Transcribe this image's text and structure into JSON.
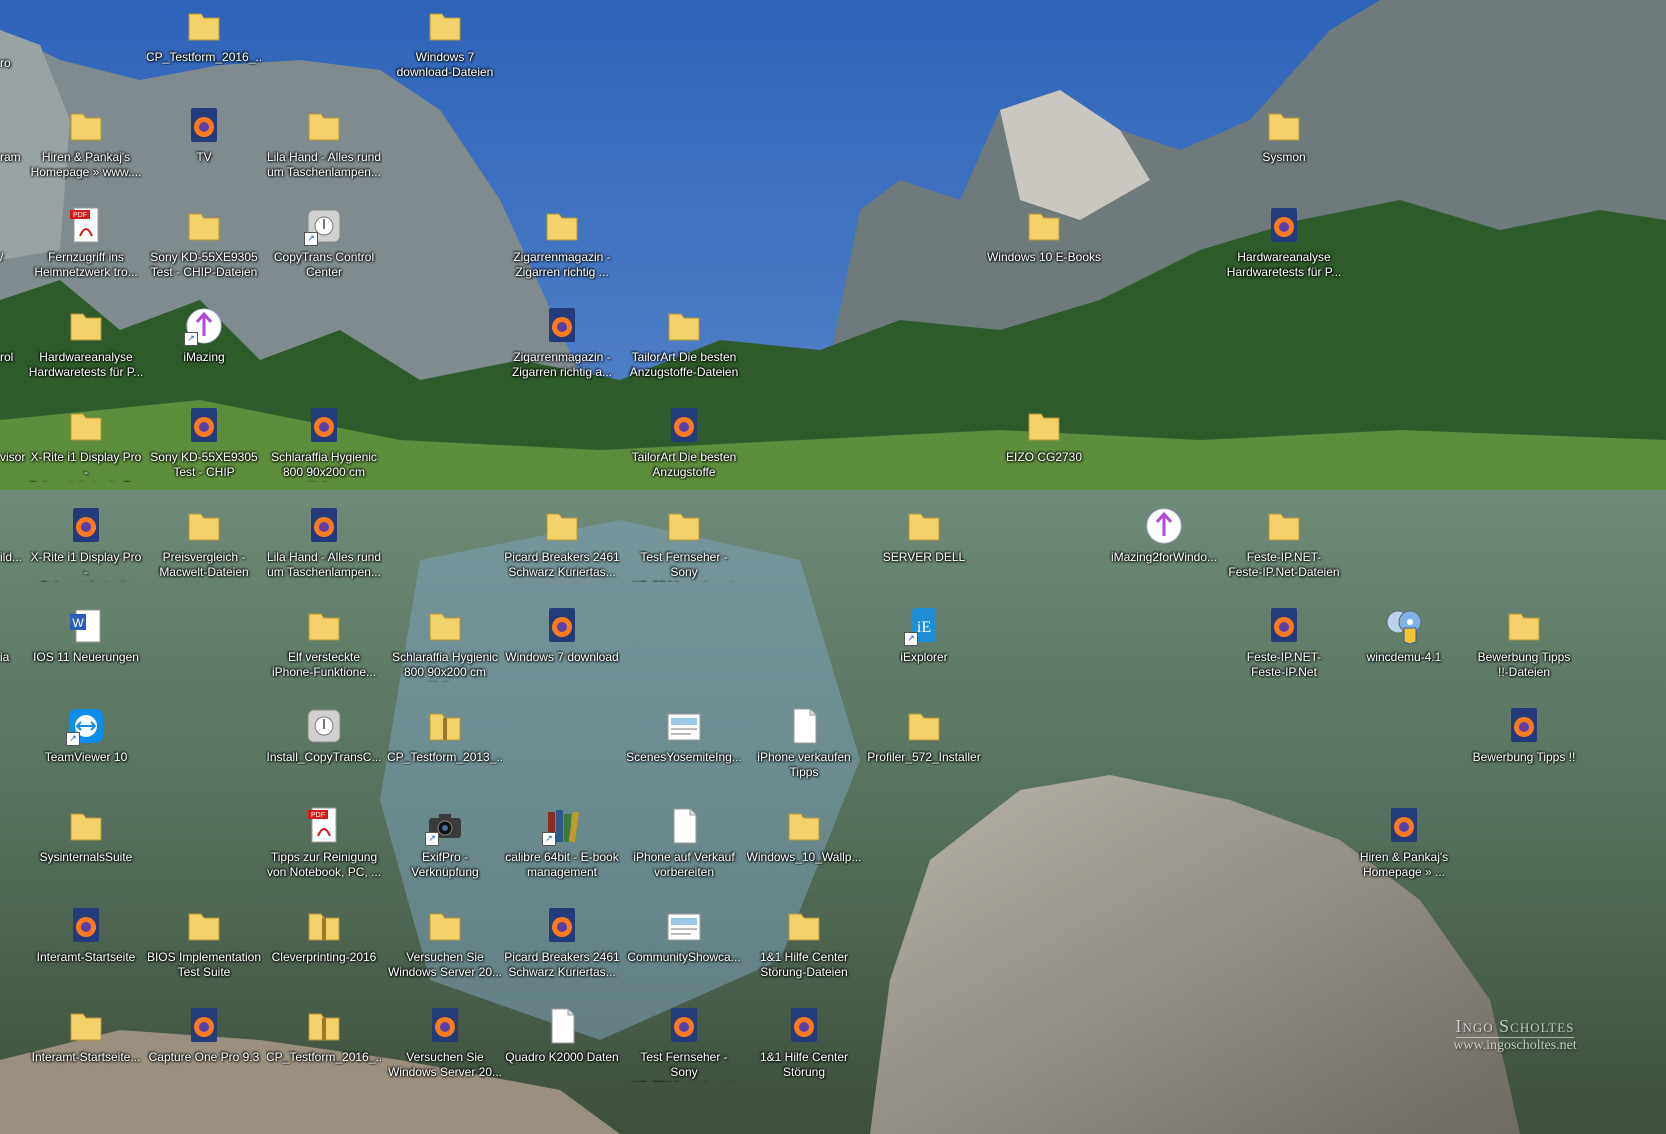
{
  "desktop": {
    "icons": [
      {
        "label": "ro",
        "type": "edge-text"
      },
      {
        "label": "CP_Testform_2016_...",
        "type": "folder"
      },
      {
        "label": "Windows 7\ndownload-Dateien",
        "type": "folder"
      },
      {
        "label": "ram",
        "type": "edge-text"
      },
      {
        "label": "Hiren & Pankaj's\nHomepage » www....",
        "type": "folder"
      },
      {
        "label": "TV",
        "type": "firefox"
      },
      {
        "label": "Lila Hand - Alles rund\num Taschenlampen...",
        "type": "folder"
      },
      {
        "label": "Sysmon",
        "type": "folder"
      },
      {
        "label": "/",
        "type": "edge-text"
      },
      {
        "label": "Fernzugriff ins\nHeimnetzwerk tro...",
        "type": "pdf"
      },
      {
        "label": "Sony KD-55XE9305\nTest - CHIP-Dateien",
        "type": "folder"
      },
      {
        "label": "CopyTrans Control\nCenter",
        "type": "app-gray"
      },
      {
        "label": "Zigarrenmagazin -\nZigarren richtig ...",
        "type": "folder"
      },
      {
        "label": "Windows 10 E-Books",
        "type": "folder"
      },
      {
        "label": "Hardwareanalyse\nHardwaretests für P...",
        "type": "firefox"
      },
      {
        "label": "rol",
        "type": "edge-text"
      },
      {
        "label": "Hardwareanalyse\nHardwaretests für P...",
        "type": "folder"
      },
      {
        "label": "iMazing",
        "type": "imazing"
      },
      {
        "label": "Zigarrenmagazin -\nZigarren richtig a...",
        "type": "firefox"
      },
      {
        "label": "TailorArt  Die besten\nAnzugstoffe-Dateien",
        "type": "folder"
      },
      {
        "label": "visor",
        "type": "edge-text"
      },
      {
        "label": "X-Rite i1 Display Pro -\nCalumetphoto.de-D...",
        "type": "folder"
      },
      {
        "label": "Sony KD-55XE9305\nTest - CHIP",
        "type": "firefox"
      },
      {
        "label": "Schlaraffia Hygienic\n800 90x200 cm Kalt...",
        "type": "firefox"
      },
      {
        "label": "TailorArt  Die besten\nAnzugstoffe",
        "type": "firefox"
      },
      {
        "label": "EIZO CG2730",
        "type": "folder"
      },
      {
        "label": "ild...",
        "type": "edge-text"
      },
      {
        "label": "X-Rite i1 Display Pro -\nCalumetphoto.de",
        "type": "firefox"
      },
      {
        "label": "Preisvergleich -\nMacwelt-Dateien",
        "type": "folder"
      },
      {
        "label": "Lila Hand - Alles rund\num Taschenlampen...",
        "type": "firefox"
      },
      {
        "label": "Picard Breakers 2461\nSchwarz   Kuriertas...",
        "type": "folder"
      },
      {
        "label": "Test Fernseher - Sony\nKD-55A1 - sehr gut ...",
        "type": "folder"
      },
      {
        "label": "SERVER DELL",
        "type": "folder"
      },
      {
        "label": "iMazing2forWindo...",
        "type": "imazing"
      },
      {
        "label": "Feste-IP.NET-\nFeste-IP.Net-Dateien",
        "type": "folder"
      },
      {
        "label": "ia",
        "type": "edge-text"
      },
      {
        "label": "IOS 11 Neuerungen",
        "type": "word"
      },
      {
        "label": "Elf versteckte\niPhone-Funktione...",
        "type": "folder"
      },
      {
        "label": "Schlaraffia Hygienic\n800 90x200 cm Kalt...",
        "type": "folder"
      },
      {
        "label": "Windows 7 download",
        "type": "firefox"
      },
      {
        "label": "iExplorer",
        "type": "iexplorer"
      },
      {
        "label": "Feste-IP.NET-\nFeste-IP.Net",
        "type": "firefox"
      },
      {
        "label": "wincdemu-4.1",
        "type": "disc"
      },
      {
        "label": "Bewerbung Tipps\n!!-Dateien",
        "type": "folder"
      },
      {
        "label": "TeamViewer 10",
        "type": "teamviewer"
      },
      {
        "label": "Install_CopyTransC...",
        "type": "app-gray"
      },
      {
        "label": "CP_Testform_2013_...",
        "type": "zip"
      },
      {
        "label": "ScenesYosemiteIng...",
        "type": "image-file"
      },
      {
        "label": "iPhone verkaufen\nTipps",
        "type": "doc"
      },
      {
        "label": "Profiler_572_Installer",
        "type": "folder"
      },
      {
        "label": "Bewerbung Tipps !!",
        "type": "firefox"
      },
      {
        "label": "SysinternalsSuite",
        "type": "folder"
      },
      {
        "label": "Tipps zur Reinigung\nvon Notebook, PC, ...",
        "type": "pdf"
      },
      {
        "label": "ExifPro - Verknüpfung",
        "type": "camera"
      },
      {
        "label": "calibre 64bit - E-book\nmanagement",
        "type": "books"
      },
      {
        "label": "iPhone auf Verkauf\nvorbereiten",
        "type": "doc"
      },
      {
        "label": "Windows_10_Wallp...",
        "type": "folder"
      },
      {
        "label": "Hiren & Pankaj's\nHomepage » ...",
        "type": "firefox"
      },
      {
        "label": "Interamt-Startseite",
        "type": "firefox"
      },
      {
        "label": "BIOS Implementation\nTest Suite",
        "type": "folder"
      },
      {
        "label": "Cleverprinting-2016",
        "type": "zip"
      },
      {
        "label": "Versuchen Sie\nWindows Server 20...",
        "type": "folder"
      },
      {
        "label": "Picard Breakers 2461\nSchwarz   Kuriertas...",
        "type": "firefox"
      },
      {
        "label": "CommunityShowca...",
        "type": "image-file"
      },
      {
        "label": "1&1 Hilfe Center\nStörung-Dateien",
        "type": "folder"
      },
      {
        "label": "Interamt-Startseite...",
        "type": "folder"
      },
      {
        "label": "Capture One Pro 9.3",
        "type": "firefox"
      },
      {
        "label": "CP_Testform_2016_...",
        "type": "zip"
      },
      {
        "label": "Versuchen Sie\nWindows Server 20...",
        "type": "firefox"
      },
      {
        "label": "Quadro K2000 Daten",
        "type": "doc"
      },
      {
        "label": "Test Fernseher - Sony\nKD-55A1 - sehr gut ...",
        "type": "firefox"
      },
      {
        "label": "1&1 Hilfe Center\nStörung",
        "type": "firefox"
      }
    ]
  },
  "watermark": {
    "name": "Ingo Scholtes",
    "url": "www.ingoscholtes.net"
  },
  "colors": {
    "folder": "#f2d36b",
    "firefox": "#ff7a1a",
    "sky": "#3d78c9"
  }
}
